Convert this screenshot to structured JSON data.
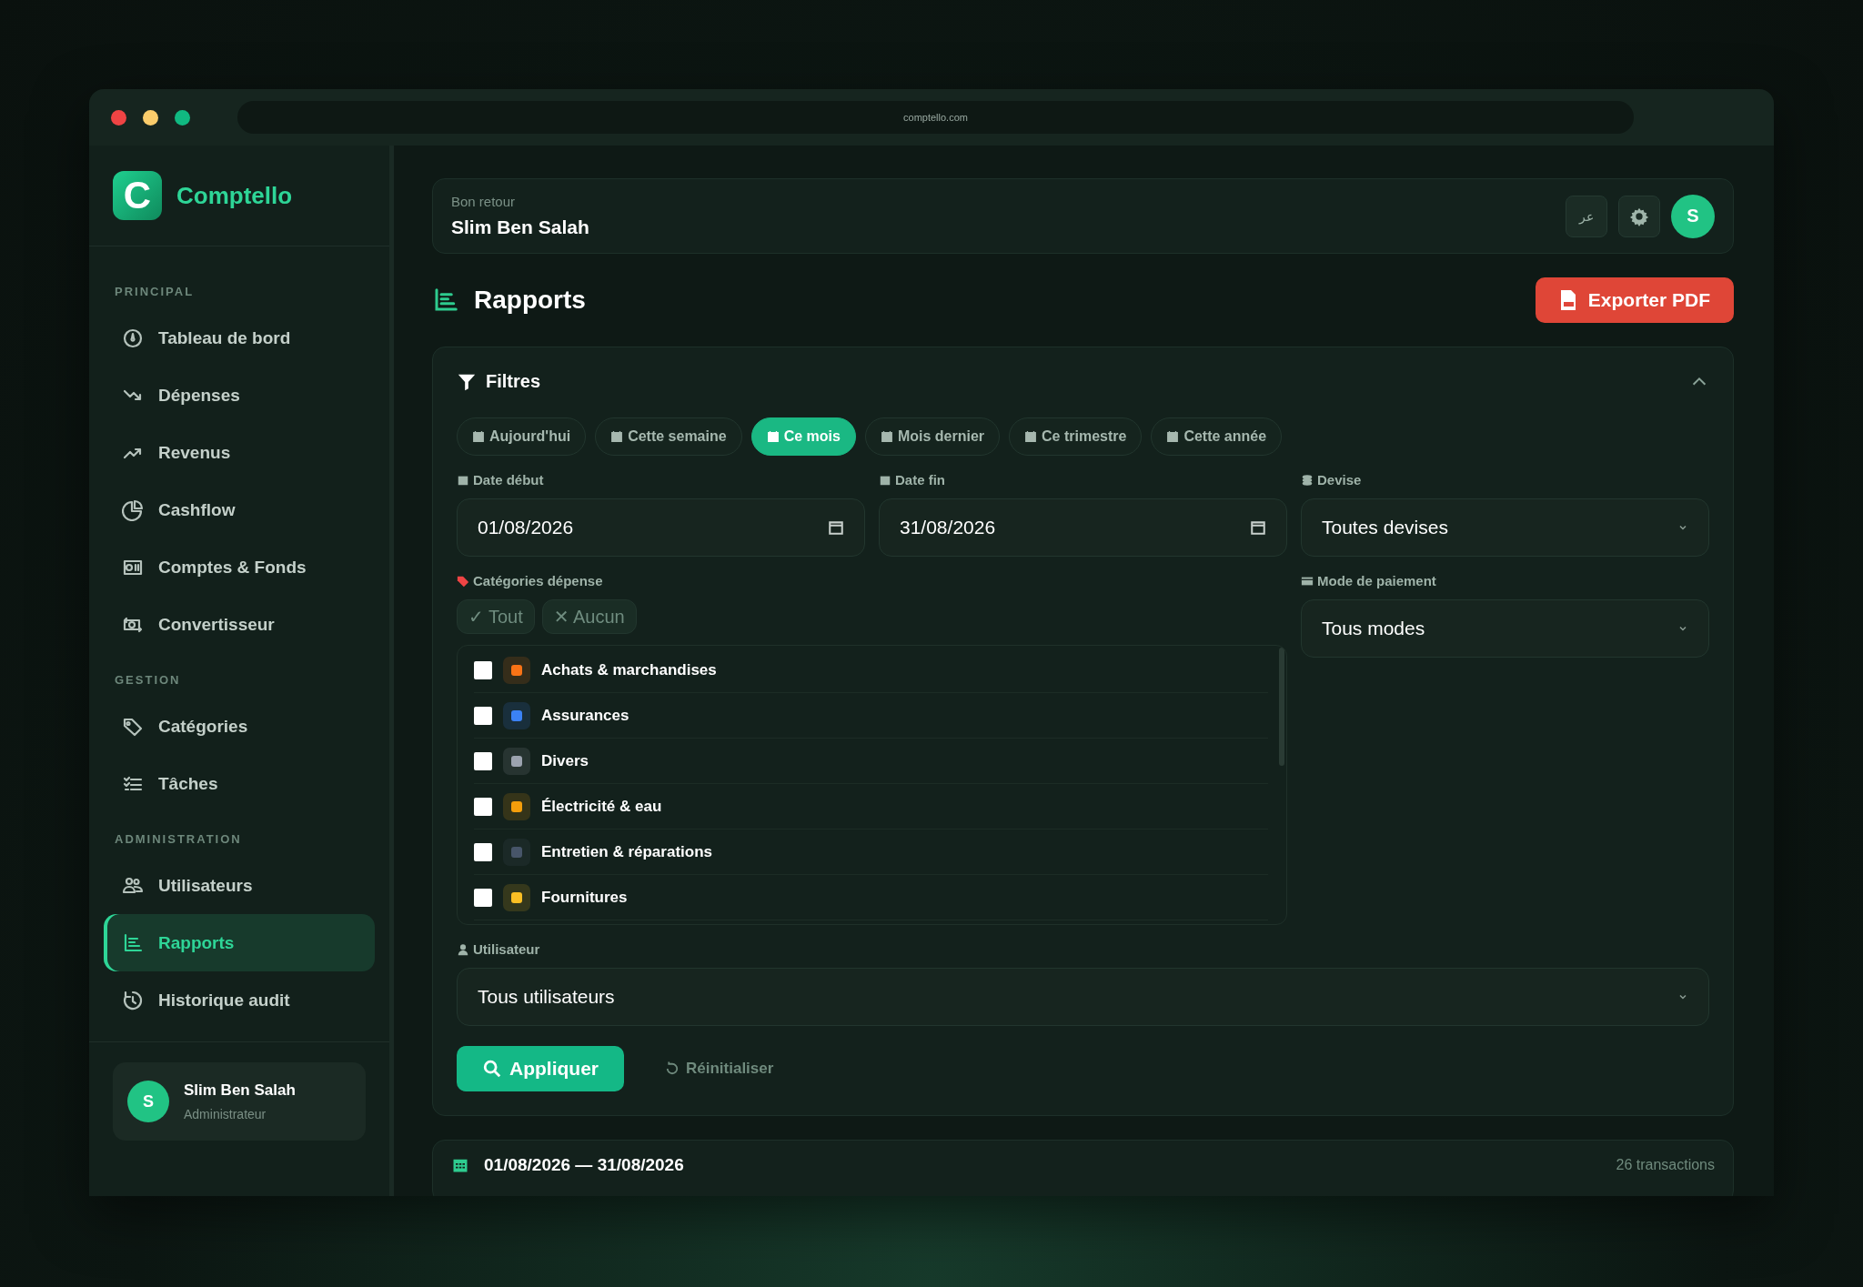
{
  "browser": {
    "url": "comptello.com"
  },
  "sidebar": {
    "logo_letter": "C",
    "brand": "Comptello",
    "sections": [
      {
        "title": "PRINCIPAL",
        "items": [
          {
            "label": "Tableau de bord",
            "selected": false
          },
          {
            "label": "Dépenses",
            "selected": false
          },
          {
            "label": "Revenus",
            "selected": false
          },
          {
            "label": "Cashflow",
            "selected": false
          },
          {
            "label": "Comptes & Fonds",
            "selected": false
          },
          {
            "label": "Convertisseur",
            "selected": false
          }
        ]
      },
      {
        "title": "GESTION",
        "items": [
          {
            "label": "Catégories",
            "selected": false
          },
          {
            "label": "Tâches",
            "selected": false
          }
        ]
      },
      {
        "title": "ADMINISTRATION",
        "items": [
          {
            "label": "Utilisateurs",
            "selected": false
          },
          {
            "label": "Rapports",
            "selected": true
          },
          {
            "label": "Historique audit",
            "selected": false
          }
        ]
      }
    ],
    "user": {
      "initial": "S",
      "name": "Slim Ben Salah",
      "role": "Administrateur"
    }
  },
  "header": {
    "greeting": "Bon retour",
    "name": "Slim Ben Salah",
    "lang_button": "عر",
    "avatar": "S"
  },
  "page": {
    "title": "Rapports",
    "export_button": "Exporter PDF"
  },
  "filters": {
    "title": "Filtres",
    "presets": [
      {
        "label": "Aujourd'hui",
        "selected": false
      },
      {
        "label": "Cette semaine",
        "selected": false
      },
      {
        "label": "Ce mois",
        "selected": true
      },
      {
        "label": "Mois dernier",
        "selected": false
      },
      {
        "label": "Ce trimestre",
        "selected": false
      },
      {
        "label": "Cette année",
        "selected": false
      }
    ],
    "date_start": {
      "label": "Date début",
      "value": "01/08/2026"
    },
    "date_end": {
      "label": "Date fin",
      "value": "31/08/2026"
    },
    "currency": {
      "label": "Devise",
      "value": "Toutes devises"
    },
    "categories": {
      "label": "Catégories dépense",
      "all_button": "✓ Tout",
      "none_button": "✕ Aucun",
      "items": [
        {
          "label": "Achats & marchandises",
          "checked": false,
          "color": "#f97316"
        },
        {
          "label": "Assurances",
          "checked": false,
          "color": "#3b82f6"
        },
        {
          "label": "Divers",
          "checked": false,
          "color": "#9ca3af"
        },
        {
          "label": "Électricité & eau",
          "checked": false,
          "color": "#f59e0b"
        },
        {
          "label": "Entretien & réparations",
          "checked": false,
          "color": "#475569"
        },
        {
          "label": "Fournitures",
          "checked": false,
          "color": "#fbbf24"
        }
      ]
    },
    "payment": {
      "label": "Mode de paiement",
      "value": "Tous modes"
    },
    "user": {
      "label": "Utilisateur",
      "value": "Tous utilisateurs"
    },
    "apply_button": "Appliquer",
    "reset_button": "Réinitialiser"
  },
  "summary": {
    "range": "01/08/2026 — 31/08/2026",
    "count": "26 transactions"
  }
}
